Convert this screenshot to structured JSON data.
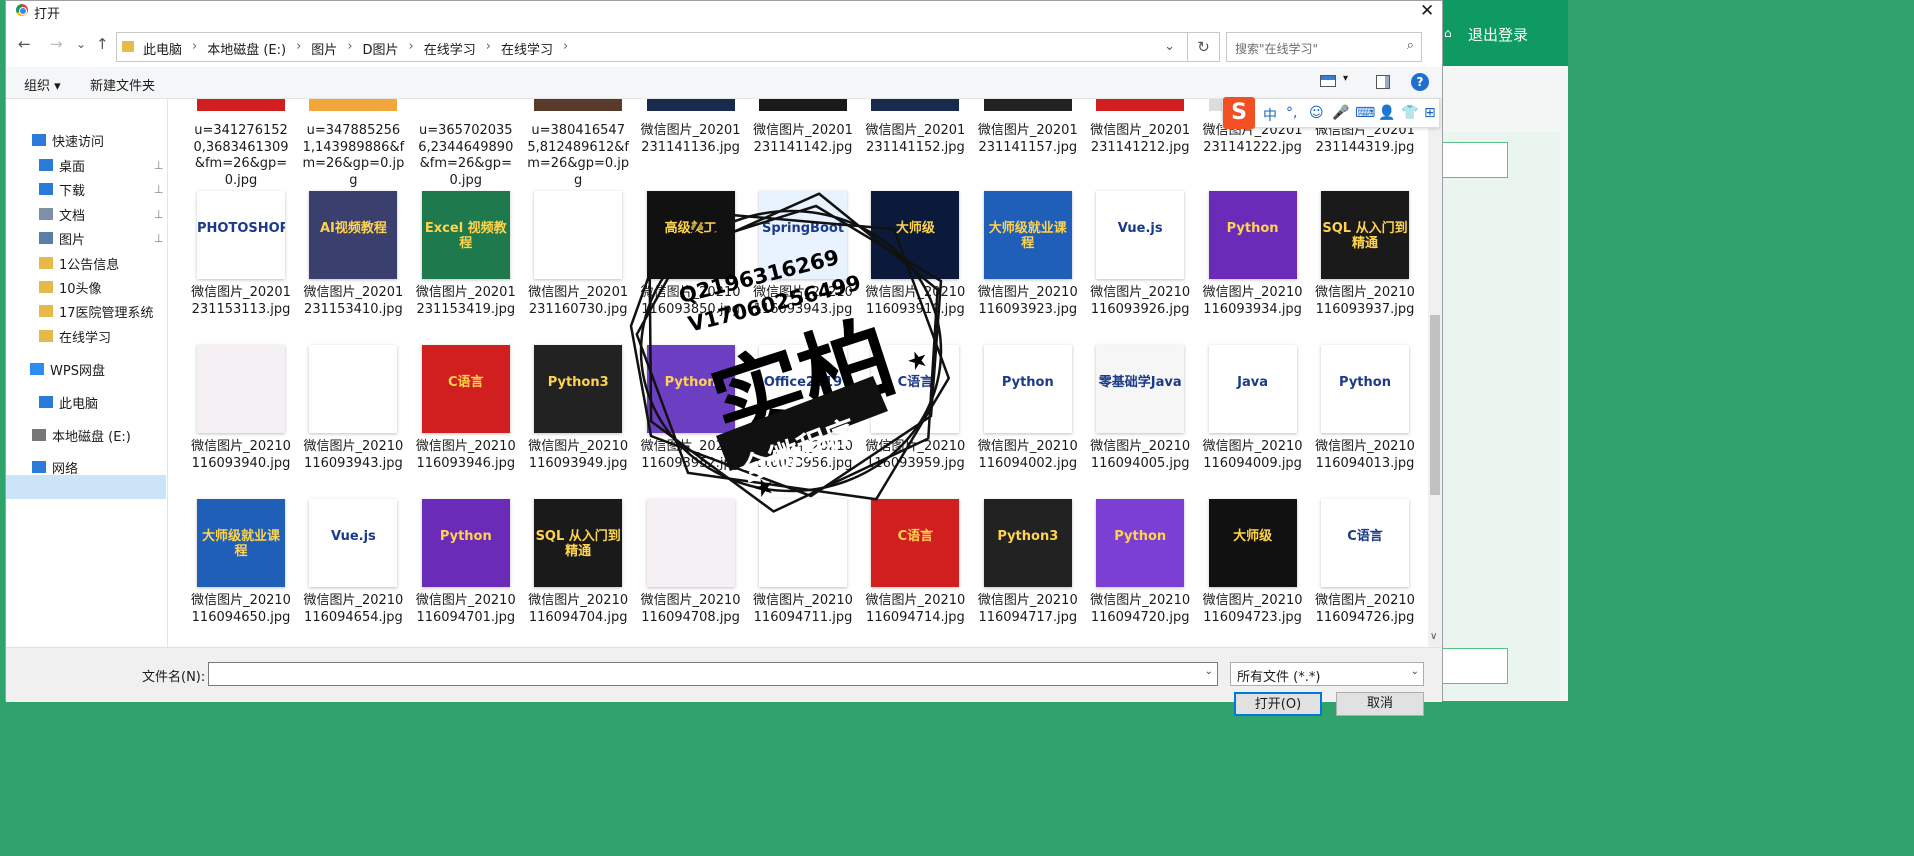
{
  "background_app": {
    "logout_label": "退出登录"
  },
  "dialog": {
    "title": "打开",
    "close_glyph": "✕",
    "nav": {
      "back": "←",
      "forward": "→",
      "recent": "⌄",
      "up": "↑"
    },
    "breadcrumbs": [
      "此电脑",
      "本地磁盘 (E:)",
      "图片",
      "D图片",
      "在线学习",
      "在线学习"
    ],
    "breadcrumb_separator": "›",
    "refresh_glyph": "↻",
    "search_placeholder": "搜索\"在线学习\"",
    "toolbar": {
      "organize": "组织 ▾",
      "new_folder": "新建文件夹",
      "help": "?"
    },
    "sidebar": [
      {
        "label": "快速访问",
        "icon": "star-icon",
        "pinned": false
      },
      {
        "label": "桌面",
        "icon": "desktop-icon",
        "pinned": true
      },
      {
        "label": "下载",
        "icon": "download-icon",
        "pinned": true
      },
      {
        "label": "文档",
        "icon": "document-icon",
        "pinned": true
      },
      {
        "label": "图片",
        "icon": "picture-icon",
        "pinned": true
      },
      {
        "label": "1公告信息",
        "icon": "folder-icon",
        "pinned": false
      },
      {
        "label": "10头像",
        "icon": "folder-icon",
        "pinned": false
      },
      {
        "label": "17医院管理系统",
        "icon": "folder-icon",
        "pinned": false
      },
      {
        "label": "在线学习",
        "icon": "folder-icon",
        "pinned": false
      },
      {
        "label": "WPS网盘",
        "icon": "cloud-icon",
        "pinned": false
      },
      {
        "label": "此电脑",
        "icon": "computer-icon",
        "pinned": false
      },
      {
        "label": "本地磁盘 (E:)",
        "icon": "drive-icon",
        "pinned": false
      },
      {
        "label": "网络",
        "icon": "network-icon",
        "pinned": false
      }
    ],
    "pin_glyph": "📌",
    "rows": [
      [
        "u=3412761520,3683461309&fm=26&gp=0.jpg",
        "u=3478852561,143989886&fm=26&gp=0.jpg",
        "u=3657020356,2344649890&fm=26&gp=0.jpg",
        "u=3804165475,812489612&fm=26&gp=0.jpg",
        "微信图片_20201231141136.jpg",
        "微信图片_20201231141142.jpg",
        "微信图片_20201231141152.jpg",
        "微信图片_20201231141157.jpg",
        "微信图片_20201231141212.jpg",
        "微信图片_20201231141222.jpg",
        "微信图片_20201231144319.jpg"
      ],
      [
        "微信图片_20201231153113.jpg",
        "微信图片_20201231153410.jpg",
        "微信图片_20201231153419.jpg",
        "微信图片_20201231160730.jpg",
        "微信图片_20210116093850.jpg",
        "微信图片_20210116093943.jpg",
        "微信图片_20210116093919.jpg",
        "微信图片_20210116093923.jpg",
        "微信图片_20210116093926.jpg",
        "微信图片_20210116093934.jpg",
        "微信图片_20210116093937.jpg"
      ],
      [
        "微信图片_20210116093940.jpg",
        "微信图片_20210116093943.jpg",
        "微信图片_20210116093946.jpg",
        "微信图片_20210116093949.jpg",
        "微信图片_20210116093952.jpg",
        "微信图片_20210116093956.jpg",
        "微信图片_20210116093959.jpg",
        "微信图片_20210116094002.jpg",
        "微信图片_20210116094005.jpg",
        "微信图片_20210116094009.jpg",
        "微信图片_20210116094013.jpg"
      ],
      [
        "微信图片_20210116094650.jpg",
        "微信图片_20210116094654.jpg",
        "微信图片_20210116094701.jpg",
        "微信图片_20210116094704.jpg",
        "微信图片_20210116094708.jpg",
        "微信图片_20210116094711.jpg",
        "微信图片_20210116094714.jpg",
        "微信图片_20210116094717.jpg",
        "微信图片_20210116094720.jpg",
        "微信图片_20210116094723.jpg",
        "微信图片_20210116094726.jpg"
      ]
    ],
    "thumb_texts": {
      "r1": [
        "PHOTOSHOP",
        "AI视频教程",
        "Excel 视频教程",
        "",
        "高级美工",
        "SpringBoot",
        "大师级",
        "大师级就业课程",
        "Vue.js",
        "Python",
        "SQL 从入门到精通"
      ],
      "r2": [
        "",
        "",
        "C语言",
        "Python3",
        "Python",
        "Office2019",
        "C语言",
        "Python",
        "零基础学Java",
        "Java",
        "Python"
      ],
      "r3": [
        "大师级就业课程",
        "Vue.js",
        "Python",
        "SQL 从入门到精通",
        "",
        "",
        "C语言",
        "Python3",
        "Python",
        "大师级",
        "C语言"
      ]
    },
    "thumb_colors": {
      "r1": [
        "#ffffff",
        "#3a3f6e",
        "#1e7a4c",
        "#ffffff",
        "#111111",
        "#e8f3ff",
        "#0b1a3a",
        "#1f5fb8",
        "#ffffff",
        "#6a2bb8",
        "#1a1a1a"
      ],
      "r2": [
        "#f4f0f4",
        "#ffffff",
        "#d11e1e",
        "#222222",
        "#6c3fc2",
        "#ffffff",
        "#ffffff",
        "#ffffff",
        "#f6f6f6",
        "#ffffff",
        "#ffffff"
      ],
      "r3": [
        "#1f5fb8",
        "#ffffff",
        "#6a2bb8",
        "#1a1a1a",
        "#f4f0f4",
        "#ffffff",
        "#d11e1e",
        "#222222",
        "#7b3fd4",
        "#111111",
        "#ffffff"
      ]
    },
    "stamp": {
      "line1": "Q2196316269",
      "line2": "V17060256499",
      "main": "实柏",
      "banner": "全微程序"
    },
    "filename_label": "文件名(N):",
    "filename_value": "",
    "filetype_value": "所有文件 (*.*)",
    "open_label": "打开(O)",
    "cancel_label": "取消"
  },
  "ime_toolbar": {
    "logo": "S",
    "items": [
      "中",
      "°,",
      "☺",
      "🎤",
      "⌨",
      "👤",
      "👕",
      "⊞"
    ]
  }
}
